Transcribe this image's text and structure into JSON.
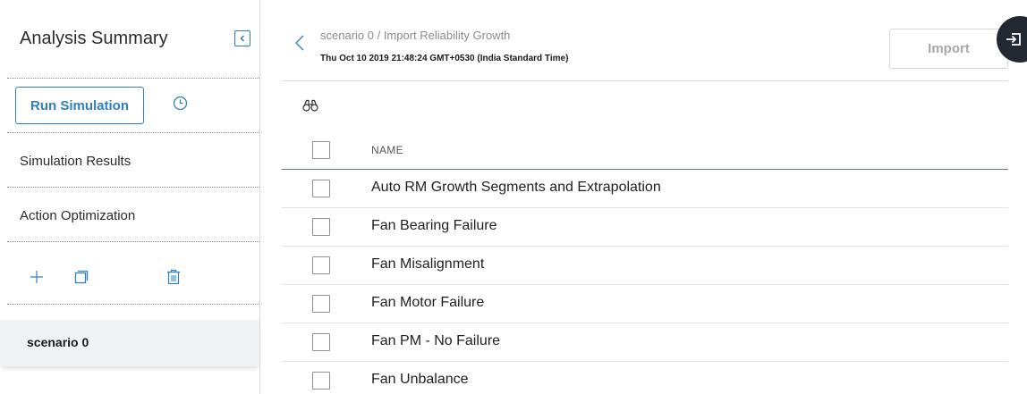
{
  "sidebar": {
    "title": "Analysis Summary",
    "run_button": "Run Simulation",
    "items": [
      {
        "label": "Simulation Results"
      },
      {
        "label": "Action Optimization"
      }
    ],
    "scenario": "scenario 0",
    "icons": [
      "collapse-sidebar-icon",
      "clock-icon",
      "plus-icon",
      "copy-icon",
      "trash-icon"
    ]
  },
  "header": {
    "breadcrumb": "scenario 0 / Import Reliability Growth",
    "timestamp": "Thu Oct 10 2019 21:48:24 GMT+0530 (India Standard Time)",
    "import_button": "Import"
  },
  "table": {
    "column_name": "NAME",
    "rows": [
      {
        "name": "Auto RM Growth Segments and Extrapolation"
      },
      {
        "name": "Fan Bearing Failure"
      },
      {
        "name": "Fan Misalignment"
      },
      {
        "name": "Fan Motor Failure"
      },
      {
        "name": "Fan PM - No Failure"
      },
      {
        "name": "Fan Unbalance"
      }
    ]
  },
  "colors": {
    "accent": "#2e7fc3",
    "fab": "#222830",
    "selected_row": "#f0f3f6"
  }
}
